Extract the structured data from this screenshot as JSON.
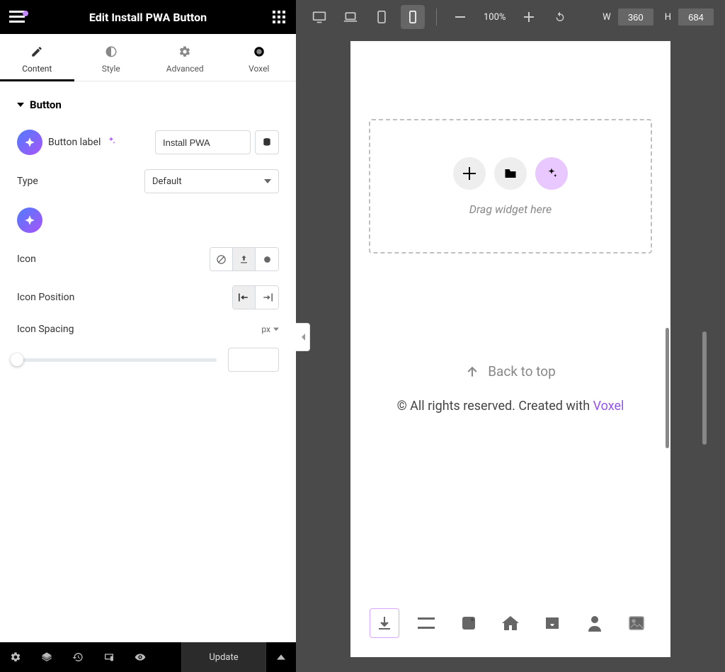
{
  "header": {
    "title": "Edit Install PWA Button"
  },
  "tabs": [
    {
      "label": "Content",
      "icon": "pencil",
      "active": true
    },
    {
      "label": "Style",
      "icon": "half-circle",
      "active": false
    },
    {
      "label": "Advanced",
      "icon": "gear",
      "active": false
    },
    {
      "label": "Voxel",
      "icon": "voxel",
      "active": false
    }
  ],
  "section": {
    "title": "Button"
  },
  "fields": {
    "button_label": {
      "label": "Button label",
      "value": "Install PWA"
    },
    "type": {
      "label": "Type",
      "value": "Default"
    },
    "icon": {
      "label": "Icon"
    },
    "icon_position": {
      "label": "Icon Position"
    },
    "icon_spacing": {
      "label": "Icon Spacing",
      "unit": "px",
      "value": ""
    }
  },
  "footer": {
    "update_label": "Update"
  },
  "toolbar": {
    "zoom": "100%",
    "w_label": "W",
    "w_value": "360",
    "h_label": "H",
    "h_value": "684"
  },
  "dropzone": {
    "text": "Drag widget here"
  },
  "preview": {
    "back_to_top": "Back to top",
    "copyright_text": "© All rights reserved. Created with ",
    "copyright_link": "Voxel"
  }
}
